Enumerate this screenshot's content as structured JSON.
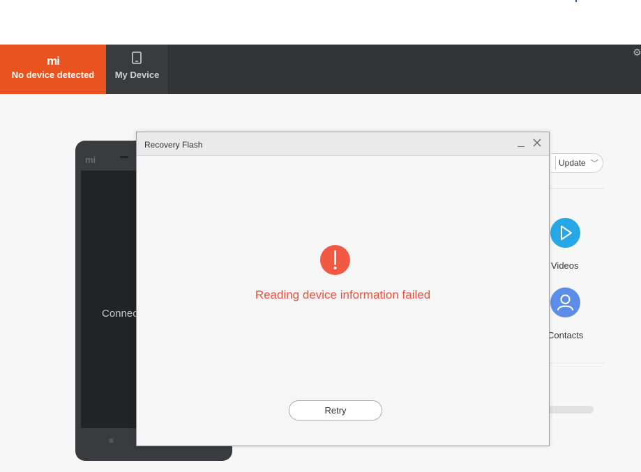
{
  "header": {
    "logo": "mi",
    "device_status": "No device detected",
    "tabs": [
      {
        "label": "My Device",
        "icon": "phone-icon"
      }
    ],
    "settings_icon": "gear-icon",
    "colors": {
      "bar": "#333436",
      "active_tab": "#e8531f"
    }
  },
  "phone_preview": {
    "logo": "mi",
    "screen_text": "Connec",
    "menu_key": "≡"
  },
  "side_panel": {
    "update_dropdown": "Update",
    "shortcuts": [
      {
        "label": "Videos",
        "icon": "play-icon",
        "color": "#27a7e6"
      },
      {
        "label": "Contacts",
        "icon": "person-icon",
        "color": "#5c8ee8"
      }
    ]
  },
  "dialog": {
    "title": "Recovery Flash",
    "error_icon": "exclamation-icon",
    "message": "Reading device information failed",
    "retry_label": "Retry",
    "accent": "#f05a45"
  }
}
